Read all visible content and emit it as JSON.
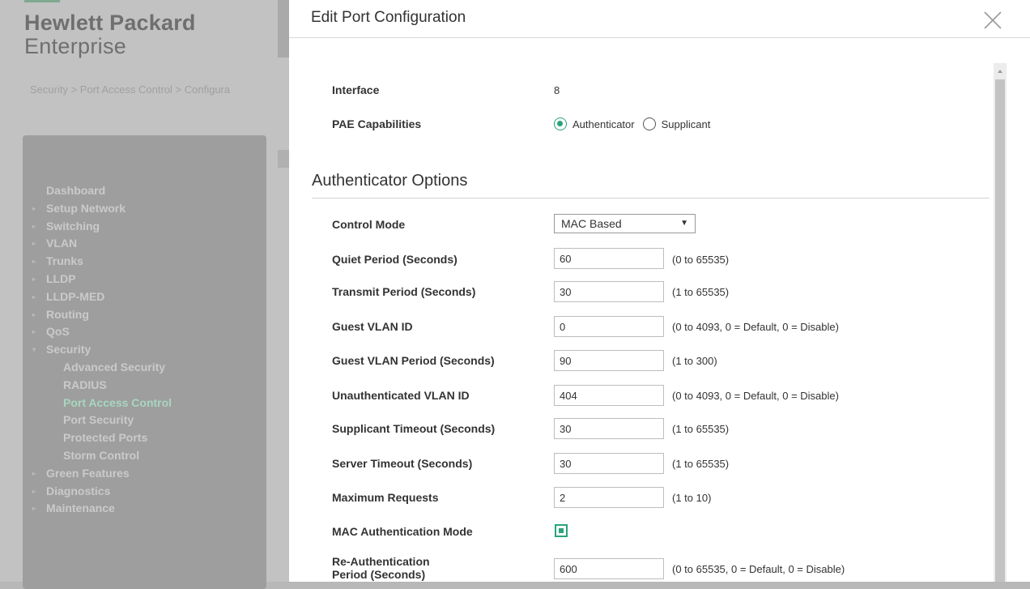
{
  "background": {
    "logo": {
      "line1": "Hewlett Packard",
      "line2": "Enterprise"
    },
    "breadcrumb": "Security > Port Access Control > Configura",
    "sidebar": {
      "items": [
        {
          "label": "Dashboard",
          "arrow": false,
          "sub": false
        },
        {
          "label": "Setup Network",
          "arrow": true,
          "sub": false
        },
        {
          "label": "Switching",
          "arrow": true,
          "sub": false
        },
        {
          "label": "VLAN",
          "arrow": true,
          "sub": false
        },
        {
          "label": "Trunks",
          "arrow": true,
          "sub": false
        },
        {
          "label": "LLDP",
          "arrow": true,
          "sub": false
        },
        {
          "label": "LLDP-MED",
          "arrow": true,
          "sub": false
        },
        {
          "label": "Routing",
          "arrow": true,
          "sub": false
        },
        {
          "label": "QoS",
          "arrow": true,
          "sub": false
        },
        {
          "label": "Security",
          "arrow": true,
          "sub": false,
          "open": true
        },
        {
          "label": "Advanced Security",
          "arrow": false,
          "sub": true
        },
        {
          "label": "RADIUS",
          "arrow": false,
          "sub": true
        },
        {
          "label": "Port Access Control",
          "arrow": false,
          "sub": true,
          "active": true
        },
        {
          "label": "Port Security",
          "arrow": false,
          "sub": true
        },
        {
          "label": "Protected Ports",
          "arrow": false,
          "sub": true
        },
        {
          "label": "Storm Control",
          "arrow": false,
          "sub": true
        },
        {
          "label": "Green Features",
          "arrow": true,
          "sub": false
        },
        {
          "label": "Diagnostics",
          "arrow": true,
          "sub": false
        },
        {
          "label": "Maintenance",
          "arrow": true,
          "sub": false
        }
      ]
    }
  },
  "modal": {
    "title": "Edit Port Configuration",
    "interface": {
      "label": "Interface",
      "value": "8"
    },
    "pae": {
      "label": "PAE Capabilities",
      "options": [
        "Authenticator",
        "Supplicant"
      ],
      "selected": "Authenticator"
    },
    "section_title": "Authenticator Options",
    "control_mode": {
      "label": "Control Mode",
      "value": "MAC Based"
    },
    "fields": {
      "quiet_period": {
        "label": "Quiet Period  (Seconds)",
        "value": "60",
        "hint": "(0 to 65535)"
      },
      "transmit_period": {
        "label": "Transmit Period  (Seconds)",
        "value": "30",
        "hint": "(1 to 65535)"
      },
      "guest_vlan_id": {
        "label": "Guest VLAN ID",
        "value": "0",
        "hint": "(0 to 4093, 0 = Default, 0 = Disable)"
      },
      "guest_vlan_period": {
        "label": "Guest VLAN Period  (Seconds)",
        "value": "90",
        "hint": "(1 to 300)"
      },
      "unauth_vlan_id": {
        "label": "Unauthenticated VLAN ID",
        "value": "404",
        "hint": "(0 to 4093, 0 = Default, 0 = Disable)"
      },
      "supplicant_timeout": {
        "label": "Supplicant Timeout  (Seconds)",
        "value": "30",
        "hint": "(1 to 65535)"
      },
      "server_timeout": {
        "label": "Server Timeout  (Seconds)",
        "value": "30",
        "hint": "(1 to 65535)"
      },
      "max_requests": {
        "label": "Maximum Requests",
        "value": "2",
        "hint": "(1 to 10)"
      },
      "reauth_period": {
        "label_line1": "Re-Authentication",
        "label_line2": "Period  (Seconds)",
        "value": "600",
        "hint": "(0 to 65535, 0 = Default, 0 = Disable)"
      }
    },
    "mac_auth_mode": {
      "label": "MAC Authentication Mode",
      "checked": true
    }
  },
  "colors": {
    "accent": "#2aa37b",
    "sidebar_active": "#a7d6c0"
  }
}
